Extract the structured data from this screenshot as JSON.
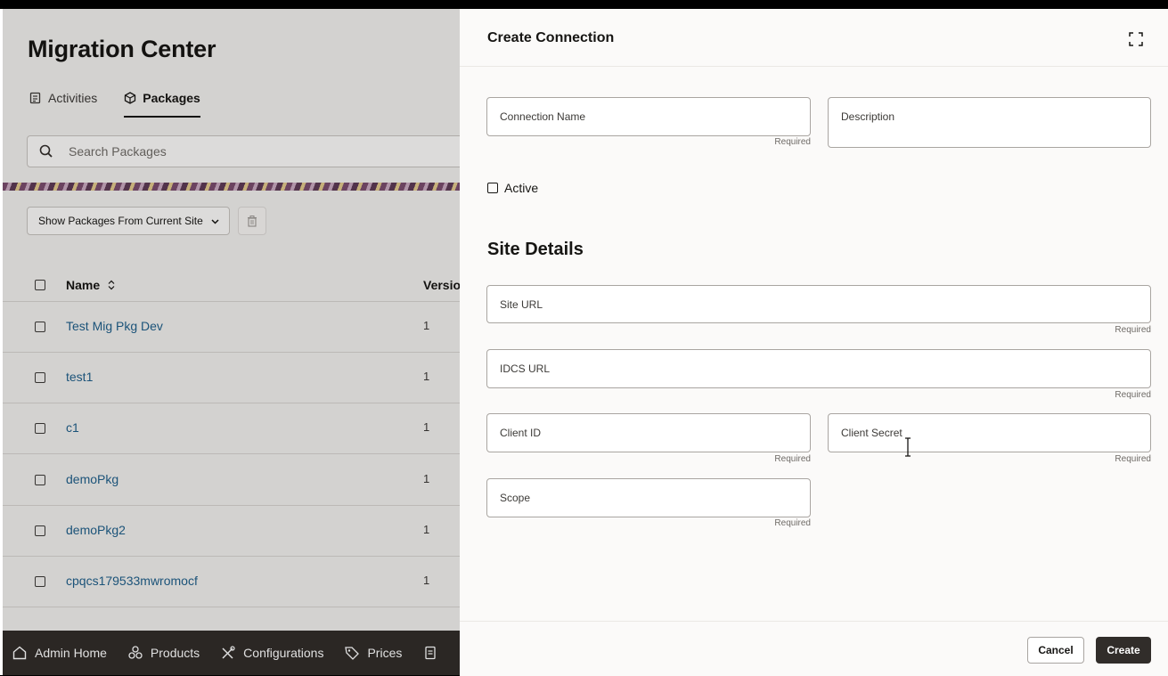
{
  "page": {
    "title": "Migration Center",
    "tabs": [
      {
        "label": "Activities",
        "icon": "activities-icon"
      },
      {
        "label": "Packages",
        "icon": "package-icon",
        "active": true
      }
    ],
    "search": {
      "placeholder": "Search Packages",
      "value": ""
    },
    "filter": {
      "selected": "Show Packages From Current Site"
    },
    "table": {
      "columns": [
        "Name",
        "Version"
      ],
      "rows": [
        {
          "name": "Test Mig Pkg Dev",
          "version": "1"
        },
        {
          "name": "test1",
          "version": "1"
        },
        {
          "name": "c1",
          "version": "1"
        },
        {
          "name": "demoPkg",
          "version": "1"
        },
        {
          "name": "demoPkg2",
          "version": "1"
        },
        {
          "name": "cpqcs179533mwromocf",
          "version": "1"
        }
      ]
    }
  },
  "bottom_nav": [
    {
      "label": "Admin Home",
      "icon": "home-icon"
    },
    {
      "label": "Products",
      "icon": "products-icon"
    },
    {
      "label": "Configurations",
      "icon": "tools-icon"
    },
    {
      "label": "Prices",
      "icon": "price-tag-icon"
    }
  ],
  "drawer": {
    "title": "Create Connection",
    "fields": {
      "connection_name": {
        "label": "Connection Name",
        "hint": "Required",
        "value": ""
      },
      "description": {
        "label": "Description",
        "value": ""
      },
      "active": {
        "label": "Active",
        "checked": false
      },
      "section_title": "Site Details",
      "site_url": {
        "label": "Site URL",
        "hint": "Required",
        "value": ""
      },
      "idcs_url": {
        "label": "IDCS URL",
        "hint": "Required",
        "value": ""
      },
      "client_id": {
        "label": "Client ID",
        "hint": "Required",
        "value": ""
      },
      "client_secret": {
        "label": "Client Secret",
        "hint": "Required",
        "value": ""
      },
      "scope": {
        "label": "Scope",
        "hint": "Required",
        "value": ""
      }
    },
    "buttons": {
      "cancel": "Cancel",
      "create": "Create"
    }
  },
  "colors": {
    "link": "#1f5f8a",
    "nav_bg": "#312d2a",
    "primary_button": "#312d2a"
  }
}
